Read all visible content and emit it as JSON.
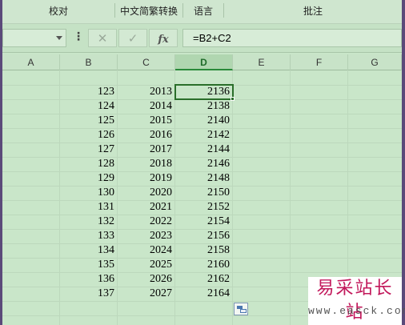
{
  "ribbon": {
    "groups": [
      "校对",
      "中文简繁转换",
      "语言",
      "批注"
    ]
  },
  "formula_bar": {
    "name_box_value": "",
    "cancel_symbol": "✕",
    "confirm_symbol": "✓",
    "fx_label": "fx",
    "formula": "=B2+C2"
  },
  "sheet": {
    "columns": [
      "A",
      "B",
      "C",
      "D",
      "E",
      "F",
      "G"
    ],
    "active_column": "D",
    "selected_cell": "D2",
    "rows": [
      {
        "B": "123",
        "C": "2013",
        "D": "2136"
      },
      {
        "B": "124",
        "C": "2014",
        "D": "2138"
      },
      {
        "B": "125",
        "C": "2015",
        "D": "2140"
      },
      {
        "B": "126",
        "C": "2016",
        "D": "2142"
      },
      {
        "B": "127",
        "C": "2017",
        "D": "2144"
      },
      {
        "B": "128",
        "C": "2018",
        "D": "2146"
      },
      {
        "B": "129",
        "C": "2019",
        "D": "2148"
      },
      {
        "B": "130",
        "C": "2020",
        "D": "2150"
      },
      {
        "B": "131",
        "C": "2021",
        "D": "2152"
      },
      {
        "B": "132",
        "C": "2022",
        "D": "2154"
      },
      {
        "B": "133",
        "C": "2023",
        "D": "2156"
      },
      {
        "B": "134",
        "C": "2024",
        "D": "2158"
      },
      {
        "B": "135",
        "C": "2025",
        "D": "2160"
      },
      {
        "B": "136",
        "C": "2026",
        "D": "2162"
      },
      {
        "B": "137",
        "C": "2027",
        "D": "2164"
      }
    ]
  },
  "watermark": {
    "title": "易采站长站",
    "url": "www.easck.com"
  },
  "colors": {
    "background": "#c9e6c9",
    "selection": "#2a6e2a",
    "watermark_title": "#c2185b"
  }
}
